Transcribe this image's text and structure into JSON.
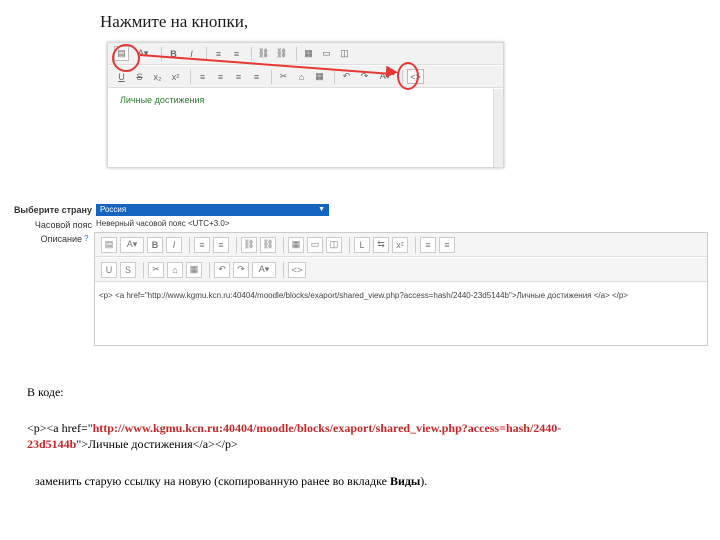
{
  "heading": "Нажмите на кнопки,",
  "shot1": {
    "content_text": "Личные достижения",
    "toolbar_row1": [
      "▤",
      "A▾",
      "B",
      "I",
      "≡",
      "≡",
      "⛓",
      "⛓",
      "▦",
      "▭",
      "◫"
    ],
    "toolbar_row2": [
      "U",
      "S",
      "x₂",
      "x²",
      "≡",
      "≡",
      "≡",
      "≡",
      "✂",
      "⌂",
      "▦",
      "↶",
      "↷",
      "A▾",
      "<>"
    ]
  },
  "form": {
    "country_label": "Выберите страну",
    "country_value": "Россия",
    "timezone_label": "Часовой пояс",
    "timezone_value": "Неверный часовой пояс <UTC+3.0>",
    "description_label": "Описание",
    "help_glyph": "?",
    "toolbar_row1": [
      "▤",
      "A▾",
      "B",
      "I",
      "≡",
      "≡",
      "⛓",
      "⛓",
      "▦",
      "▭",
      "◫",
      "L",
      "⇆",
      "x²",
      "≡",
      "≡"
    ],
    "toolbar_row2": [
      "U",
      "S",
      "✂",
      "⌂",
      "▦",
      "↶",
      "↷",
      "A▾",
      "<>"
    ],
    "code_text": "<p> <a href=\"http://www.kgmu.kcn.ru:40404/moodle/blocks/exaport/shared_view.php?access=hash/2440-23d5144b\">Личные достижения </a> </p>"
  },
  "bottom": {
    "section_title": "В коде:",
    "code_prefix": "<p><a href=\"",
    "code_url_part1": "http://www.kgmu.kcn.ru:40404/moodle/blocks/exaport/shared_view.php?access=hash/2440-",
    "code_url_part2": "23d5144b",
    "code_suffix": "\">Личные достижения</a></p>",
    "instruction_prefix": "заменить старую ссылку на новую (скопированную ранее во вкладке ",
    "instruction_bold": "Виды",
    "instruction_suffix": ")."
  }
}
